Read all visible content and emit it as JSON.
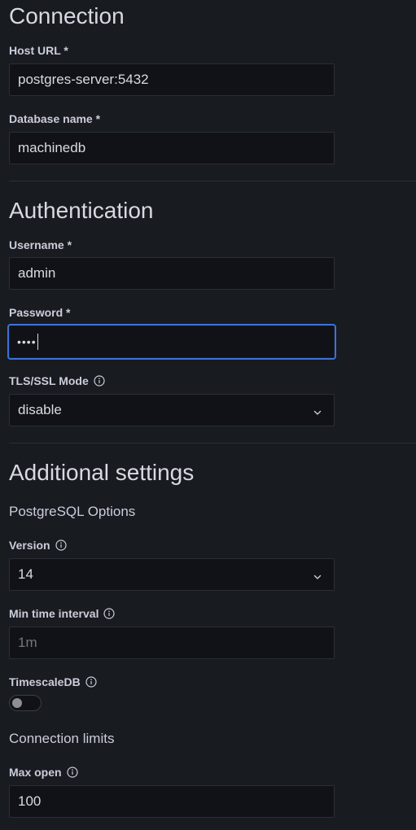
{
  "connection": {
    "heading": "Connection",
    "host_label": "Host URL *",
    "host_value": "postgres-server:5432",
    "db_label": "Database name *",
    "db_value": "machinedb"
  },
  "auth": {
    "heading": "Authentication",
    "username_label": "Username *",
    "username_value": "admin",
    "password_label": "Password *",
    "password_masked": "••••",
    "tls_label": "TLS/SSL Mode",
    "tls_value": "disable"
  },
  "additional": {
    "heading": "Additional settings",
    "pg_options_heading": "PostgreSQL Options",
    "version_label": "Version",
    "version_value": "14",
    "min_interval_label": "Min time interval",
    "min_interval_placeholder": "1m",
    "timescale_label": "TimescaleDB",
    "timescale_enabled": false,
    "limits_heading": "Connection limits",
    "max_open_label": "Max open",
    "max_open_value": "100"
  },
  "icons": {
    "info": "info-circle-icon",
    "chevron": "chevron-down-icon"
  },
  "colors": {
    "background": "#181b1f",
    "input_bg": "#111217",
    "border": "#2b2e36",
    "focus": "#3d71d9"
  }
}
